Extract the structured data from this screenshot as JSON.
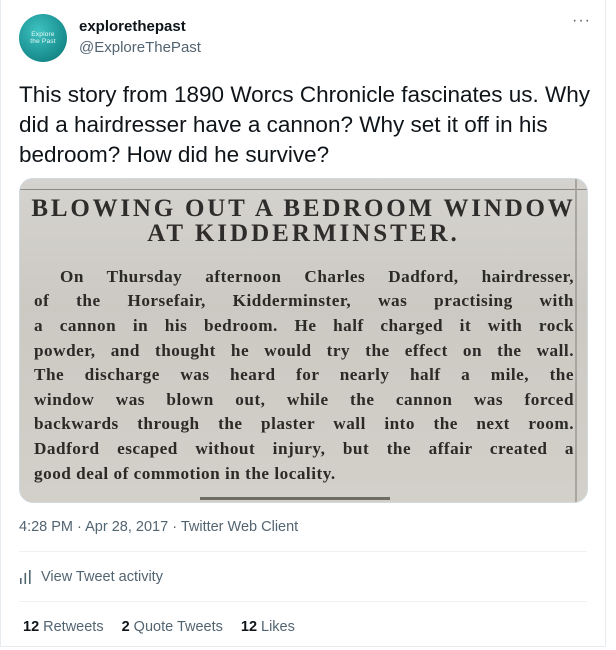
{
  "author": {
    "display_name": "explorethepast",
    "handle": "@ExploreThePast",
    "avatar_text_line1": "Explore",
    "avatar_text_line2": "the Past"
  },
  "tweet_text": "This story from 1890 Worcs Chronicle fascinates us. Why did a hairdresser have a cannon? Why set it off in his bedroom? How did he survive?",
  "media": {
    "headline_line1": "BLOWING  OUT  A  BEDROOM  WINDOW",
    "headline_line2": "AT  KIDDERMINSTER.",
    "body_lines": [
      "On Thursday afternoon Charles Dadford, hairdresser,",
      "of the Horsefair, Kidderminster, was practising with",
      "a cannon in his bedroom.  He half charged it with rock",
      "powder, and thought he would try the effect on the wall.",
      "The discharge was heard for nearly half a mile, the",
      "window was blown out, while the cannon was forced",
      "backwards through the plaster wall into the next room.",
      "Dadford escaped without injury, but the affair created a",
      "good deal of commotion in the locality."
    ]
  },
  "meta": {
    "time": "4:28 PM",
    "separator": "·",
    "date": "Apr 28, 2017",
    "client": "Twitter Web Client"
  },
  "activity_label": "View Tweet activity",
  "stats": {
    "retweets_count": "12",
    "retweets_label": "Retweets",
    "quotes_count": "2",
    "quotes_label": "Quote Tweets",
    "likes_count": "12",
    "likes_label": "Likes"
  },
  "more_label": "···"
}
